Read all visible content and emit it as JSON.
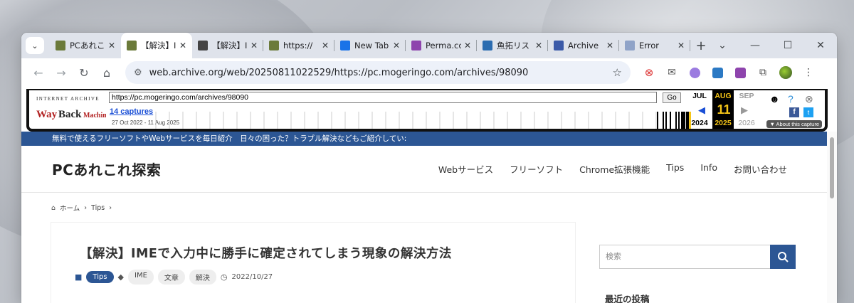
{
  "browser": {
    "tabs": [
      {
        "title": "PCあれこれ",
        "favicon": "#6b7a3a"
      },
      {
        "title": "【解決】IME",
        "favicon": "#6b7a3a",
        "active": true
      },
      {
        "title": "【解決】I",
        "favicon": "#444444"
      },
      {
        "title": "https://",
        "favicon": "#6b7a3a"
      },
      {
        "title": "New Tab",
        "favicon": "#1a73e8"
      },
      {
        "title": "Perma.cc",
        "favicon": "#8e44ad"
      },
      {
        "title": "魚拓リス",
        "favicon": "#2b6cb0"
      },
      {
        "title": "Archive",
        "favicon": "#3b5aa8"
      },
      {
        "title": "Error",
        "favicon": "#8fa3c8"
      }
    ],
    "address": "web.archive.org/web/20250811022529/https://pc.mogeringo.com/archives/98090"
  },
  "wayback": {
    "logo_top": "INTERNET ARCHIVE",
    "logo": "WayBackMachine",
    "url_value": "https://pc.mogeringo.com/archives/98090",
    "go_label": "Go",
    "captures": "14 captures",
    "range": "27 Oct 2022 - 11 Aug 2025",
    "months": {
      "prev": "JUL",
      "cur": "AUG",
      "next": "SEP"
    },
    "day": "11",
    "years": {
      "prev": "2024",
      "cur": "2025",
      "next": "2026"
    },
    "about": "▼ About this capture"
  },
  "site": {
    "tagline": "無料で使えるフリーソフトやWebサービスを毎日紹介　日々の困った？トラブル解決などもご紹介してい:",
    "title": "PCあれこれ探索",
    "nav": [
      "Webサービス",
      "フリーソフト",
      "Chrome拡張機能",
      "Tips",
      "Info",
      "お問い合わせ"
    ],
    "breadcrumb": {
      "home": "ホーム",
      "cat": "Tips"
    },
    "article": {
      "title": "【解決】IMEで入力中に勝手に確定されてしまう現象の解決方法",
      "category": "Tips",
      "tags": [
        "IME",
        "文章",
        "解決"
      ],
      "date": "2022/10/27"
    },
    "sidebar": {
      "search_placeholder": "検索",
      "recent_heading": "最近の投稿"
    }
  }
}
